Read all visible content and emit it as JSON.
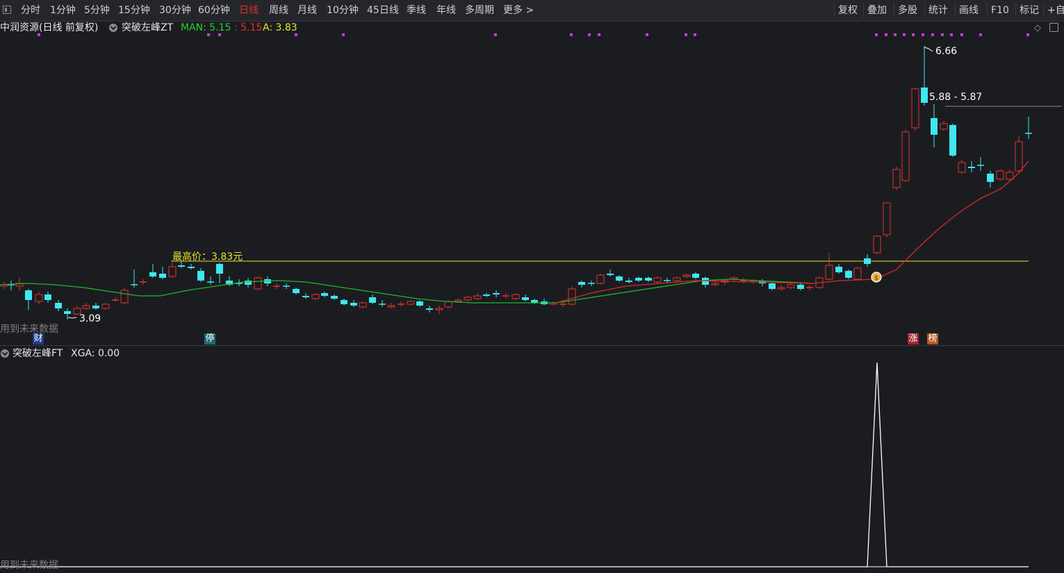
{
  "toolbar": {
    "periods": [
      "分时",
      "1分钟",
      "5分钟",
      "15分钟",
      "30分钟",
      "60分钟",
      "日线",
      "周线",
      "月线",
      "10分钟",
      "45日线",
      "季线",
      "年线",
      "多周期",
      "更多 >"
    ],
    "active_period": "日线",
    "right_buttons": [
      "复权",
      "叠加",
      "多股",
      "统计",
      "画线",
      "F10",
      "标记",
      "+自"
    ]
  },
  "main_panel": {
    "stock_name": "中润资源(日线 前复权)",
    "indicator_name": "突破左峰ZT",
    "man_label": "MAN: 5.15",
    "second_value": ": 5.15",
    "a_label": "A: 3.83",
    "high_annotation": "最高价：3.83元",
    "peak_label": "6.66",
    "low_label": "3.09",
    "range_label": "5.88 - 5.87",
    "future_data_note": "用到未来数据",
    "event_tags": [
      "财",
      "停",
      "涨",
      "榜"
    ]
  },
  "sub_panel": {
    "indicator_label": "突破左峰FT",
    "xga_label": "XGA: 0.00",
    "future_data_note": "用到未来数据"
  },
  "colors": {
    "background": "#1b1c20",
    "up_candle": "#e0332b",
    "down_candle": "#3fe7f0",
    "ma_up": "#d42a2a",
    "ma_down": "#1fb82a",
    "annotation": "#e6e62c",
    "signal_dot": "#c33fd8",
    "man_text": "#21d12b",
    "xga_line": "#ffffff"
  },
  "icons": [
    "window-icon",
    "dropdown-circle-icon",
    "diamond-icon",
    "panel-toggle-icon",
    "money-bag-icon"
  ]
}
